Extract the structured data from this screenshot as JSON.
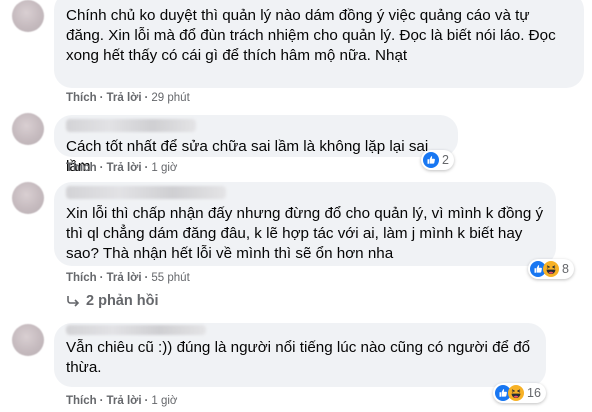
{
  "comments": [
    {
      "text": "Chính chủ ko duyệt thì quản lý nào dám đồng ý việc quảng cáo và tự đăng. Xin lỗi mà đổ đùn trách nhiệm cho quản lý. Đọc là biết nói láo. Đọc xong hết thấy có cái gì để thích hâm mộ nữa. Nhạt",
      "like_label": "Thích",
      "reply_label": "Trả lời",
      "time": "29 phút"
    },
    {
      "text": "Cách tốt nhất để sửa chữa sai lầm là không lặp lại sai lầm",
      "like_label": "Thích",
      "reply_label": "Trả lời",
      "time": "1 giờ",
      "reaction_icons": [
        "like-icon"
      ],
      "reaction_count": "2"
    },
    {
      "text": "Xin lỗi thì chấp nhận đấy nhưng đừng đổ cho quản lý, vì mình k đồng ý thì ql chẳng dám đăng đâu, k lẽ hợp tác với ai, làm j mình k biết hay sao? Thà nhận hết lỗi về mình thì sẽ ổn hơn nha",
      "like_label": "Thích",
      "reply_label": "Trả lời",
      "time": "55 phút",
      "reaction_icons": [
        "like-icon",
        "haha-icon"
      ],
      "reaction_count": "8",
      "replies_label": "2 phản hồi"
    },
    {
      "text": "Vẫn chiêu cũ :)) đúng là người nổi tiếng lúc nào cũng có người để đổ thừa.",
      "like_label": "Thích",
      "reply_label": "Trả lời",
      "time": "1 giờ",
      "reaction_icons": [
        "like-icon",
        "haha-icon"
      ],
      "reaction_count": "16"
    }
  ],
  "colors": {
    "bubble": "#f0f2f5",
    "meta": "#65676b",
    "like_blue": "#1877f2",
    "haha_yellow": "#f7b125"
  }
}
